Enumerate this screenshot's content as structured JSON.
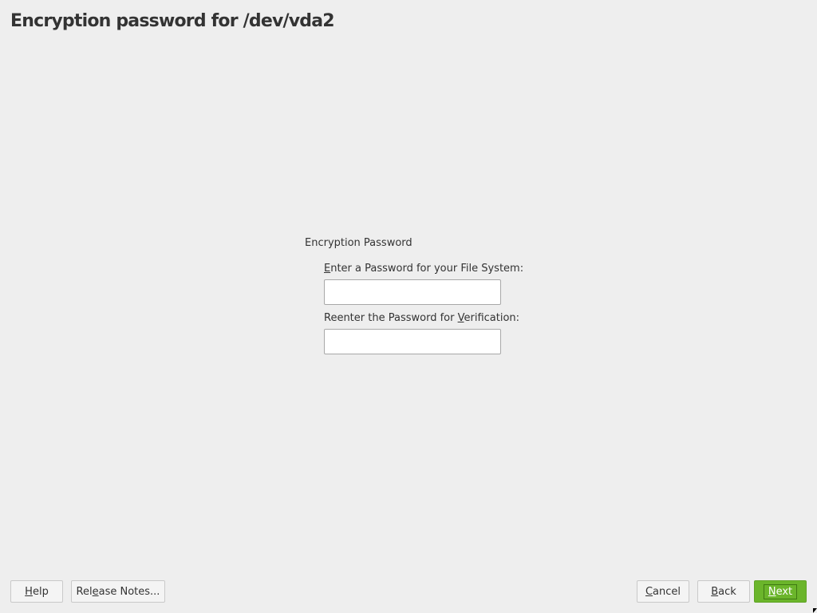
{
  "header": {
    "title": "Encryption password for /dev/vda2"
  },
  "form": {
    "frame_title": "Encryption Password",
    "password_label": {
      "mnemonic": "E",
      "rest": "nter a Password for your File System:"
    },
    "verify_label": {
      "before": "Reenter the Password for ",
      "mnemonic": "V",
      "after": "erification:"
    },
    "password_value": "",
    "verify_value": ""
  },
  "footer": {
    "help": {
      "mnemonic": "H",
      "rest": "elp"
    },
    "release_notes": {
      "before": "Rel",
      "mnemonic": "e",
      "after": "ase Notes..."
    },
    "cancel": {
      "mnemonic": "C",
      "rest": "ancel"
    },
    "back": {
      "mnemonic": "B",
      "rest": "ack"
    },
    "next": {
      "mnemonic": "N",
      "rest": "ext"
    }
  },
  "colors": {
    "background": "#eeeeee",
    "accent": "#6bb52b"
  }
}
